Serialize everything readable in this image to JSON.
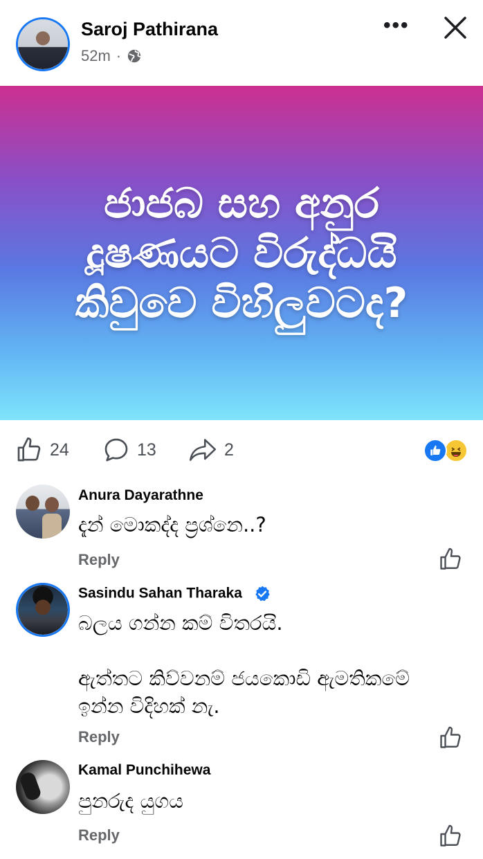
{
  "post": {
    "author": "Saroj Pathirana",
    "time": "52m",
    "separator": "·",
    "banner_text": "ජාජබ සහ අනුර දූෂණයට විරුද්ධයි කිවුවෙ විහිලුවටද?",
    "reactions_count": "24",
    "comments_count": "13",
    "shares_count": "2"
  },
  "comments": [
    {
      "name": "Anura Dayarathne",
      "text": "දැන් මොකද්ද ප්‍රශ්නෙ..?",
      "reply_label": "Reply",
      "verified": false
    },
    {
      "name": "Sasindu Sahan Tharaka",
      "text": "බලය ගන්න කම් විතරයි.\n\nඇත්තට කිව්වනම් ජයකොඩි ඇමතිකමේ ඉන්න විදිහක් නැ.",
      "reply_label": "Reply",
      "verified": true
    },
    {
      "name": "Kamal Punchihewa",
      "text": "පුනරුද යුගය",
      "reply_label": "Reply",
      "verified": false
    }
  ],
  "icons": {
    "more": "more-icon",
    "close": "close-icon",
    "globe": "globe-icon",
    "like": "like-icon",
    "comment": "comment-icon",
    "share": "share-icon",
    "like_reaction": "like-reaction-icon",
    "haha_reaction": "haha-reaction-icon",
    "verified": "verified-badge-icon",
    "comment_like": "comment-like-icon"
  },
  "colors": {
    "accent": "#1877f2",
    "banner_top": "#cc2f8f",
    "banner_bottom": "#7fe4fb",
    "muted_text": "#65676b"
  }
}
